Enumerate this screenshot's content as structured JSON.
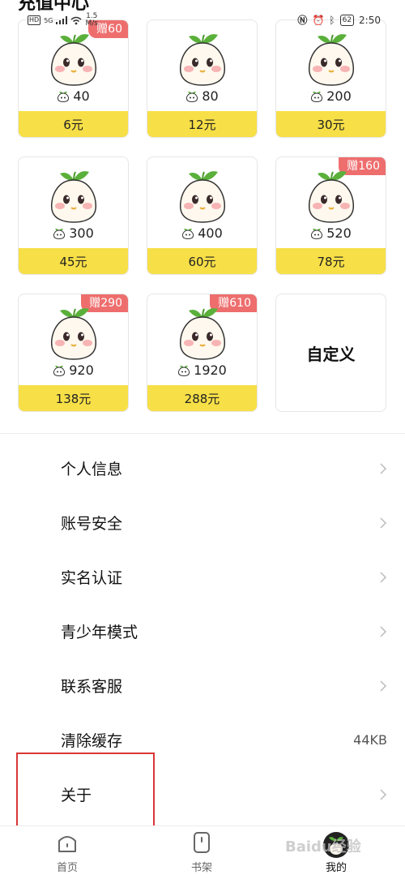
{
  "status_bar": {
    "hd": "HD",
    "signal": "5G",
    "net_speed": "1.5",
    "net_unit": "M/s",
    "battery": "62",
    "time": "2:50"
  },
  "page_title": "充值中心",
  "packages": [
    {
      "coins": "40",
      "price": "6元",
      "bonus": "赠60"
    },
    {
      "coins": "80",
      "price": "12元",
      "bonus": ""
    },
    {
      "coins": "200",
      "price": "30元",
      "bonus": ""
    },
    {
      "coins": "300",
      "price": "45元",
      "bonus": ""
    },
    {
      "coins": "400",
      "price": "60元",
      "bonus": ""
    },
    {
      "coins": "520",
      "price": "78元",
      "bonus": "赠160"
    },
    {
      "coins": "920",
      "price": "138元",
      "bonus": "赠290"
    },
    {
      "coins": "1920",
      "price": "288元",
      "bonus": "赠610"
    }
  ],
  "custom_label": "自定义",
  "menu": [
    {
      "label": "个人信息",
      "value": ""
    },
    {
      "label": "账号安全",
      "value": ""
    },
    {
      "label": "实名认证",
      "value": ""
    },
    {
      "label": "青少年模式",
      "value": ""
    },
    {
      "label": "联系客服",
      "value": ""
    },
    {
      "label": "清除缓存",
      "value": "44KB"
    },
    {
      "label": "关于",
      "value": ""
    }
  ],
  "nav": {
    "home": "首页",
    "shelf": "书架",
    "mine": "我的"
  },
  "watermark": "Baidu经验",
  "colors": {
    "price_bar": "#f7df47",
    "badge": "#ee6e6e",
    "highlight": "#d93636",
    "leaf": "#5ab03a"
  }
}
